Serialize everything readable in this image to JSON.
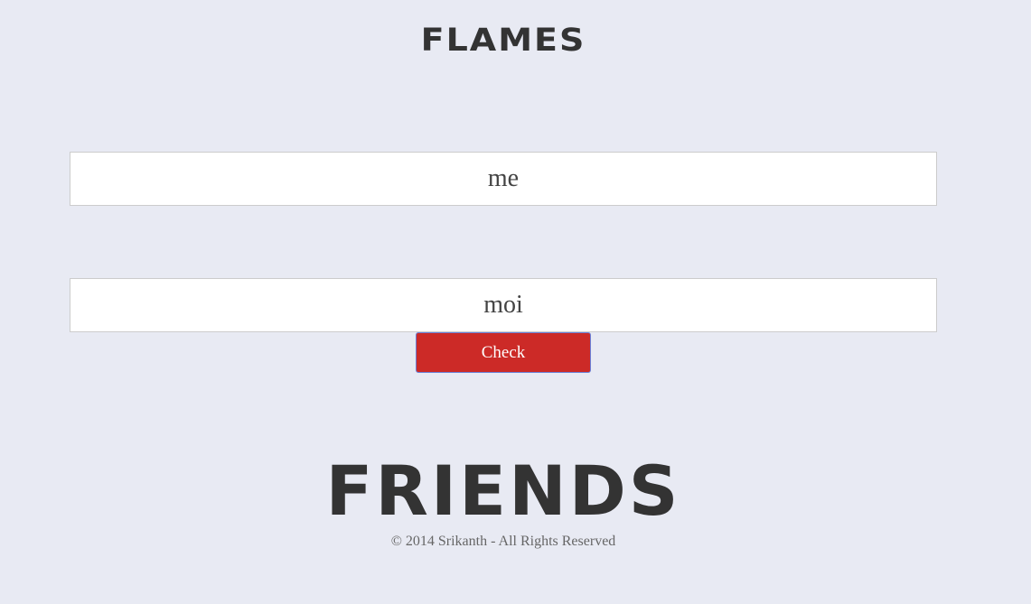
{
  "app": {
    "title": "FLAMES"
  },
  "form": {
    "name_one_value": "me",
    "name_two_value": "moi",
    "check_label": "Check"
  },
  "result": {
    "text": "FRIENDS"
  },
  "footer": {
    "copyright": "© 2014 Srikanth - All Rights Reserved"
  },
  "colors": {
    "background": "#e8eaf3",
    "button": "#cc2a27",
    "text_dark": "#333333"
  }
}
